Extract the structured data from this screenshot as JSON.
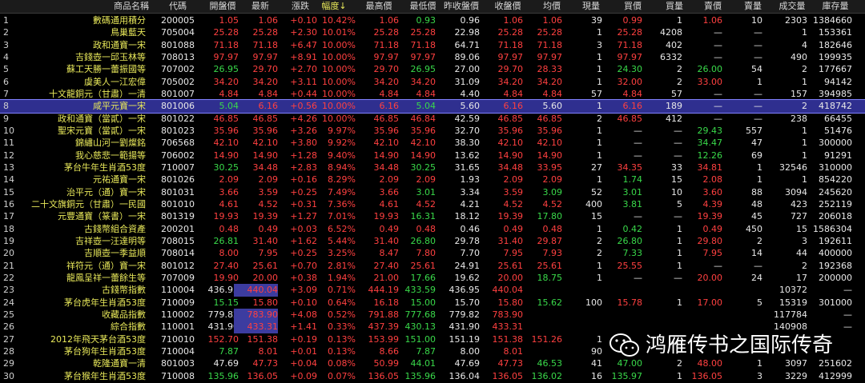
{
  "columns": [
    {
      "key": "name",
      "label": "商品名稱"
    },
    {
      "key": "code",
      "label": "代碼"
    },
    {
      "key": "open",
      "label": "開盤價"
    },
    {
      "key": "last",
      "label": "最新"
    },
    {
      "key": "chg",
      "label": "漲跌"
    },
    {
      "key": "pct",
      "label": "幅度↓"
    },
    {
      "key": "high",
      "label": "最高價"
    },
    {
      "key": "low",
      "label": "最低價"
    },
    {
      "key": "prev",
      "label": "昨收盤價"
    },
    {
      "key": "close",
      "label": "收盤價"
    },
    {
      "key": "avg",
      "label": "均價"
    },
    {
      "key": "vol_now",
      "label": "現量"
    },
    {
      "key": "bid",
      "label": "買價"
    },
    {
      "key": "bid_vol",
      "label": "買量"
    },
    {
      "key": "ask",
      "label": "賣價"
    },
    {
      "key": "ask_vol",
      "label": "賣量"
    },
    {
      "key": "volume",
      "label": "成交量"
    },
    {
      "key": "stock",
      "label": "庫存量"
    }
  ],
  "selected_row": 8,
  "rows": [
    {
      "n": "1",
      "name": "數碼通用積分",
      "code": "200005",
      "open": "1.05",
      "last": "1.06",
      "chg": "+0.10",
      "pct": "10.42%",
      "high": "1.06",
      "low": "0.93",
      "prev": "0.96",
      "close": "1.06",
      "avg": "1.06",
      "vol_now": "39",
      "bid": "0.99",
      "bid_vol": "1",
      "ask": "1.06",
      "ask_vol": "10",
      "volume": "2303",
      "stock": "1384660"
    },
    {
      "n": "2",
      "name": "鳥巢藍天",
      "code": "705004",
      "open": "25.28",
      "last": "25.28",
      "chg": "+2.30",
      "pct": "10.01%",
      "high": "25.28",
      "low": "25.28",
      "prev": "22.98",
      "close": "25.28",
      "avg": "25.28",
      "vol_now": "1",
      "bid": "25.28",
      "bid_vol": "4208",
      "ask": "—",
      "ask_vol": "—",
      "volume": "1",
      "stock": "153361"
    },
    {
      "n": "3",
      "name": "政和通寶一宋",
      "code": "801088",
      "open": "71.18",
      "last": "71.18",
      "chg": "+6.47",
      "pct": "10.00%",
      "high": "71.18",
      "low": "71.18",
      "prev": "64.71",
      "close": "71.18",
      "avg": "71.18",
      "vol_now": "3",
      "bid": "71.18",
      "bid_vol": "402",
      "ask": "—",
      "ask_vol": "—",
      "volume": "4",
      "stock": "182646"
    },
    {
      "n": "4",
      "name": "吉錢壺一邱玉林等",
      "code": "708013",
      "open": "97.97",
      "last": "97.97",
      "chg": "+8.91",
      "pct": "10.00%",
      "high": "97.97",
      "low": "97.97",
      "prev": "89.06",
      "close": "97.97",
      "avg": "97.97",
      "vol_now": "1",
      "bid": "97.97",
      "bid_vol": "6332",
      "ask": "—",
      "ask_vol": "—",
      "volume": "490",
      "stock": "199935"
    },
    {
      "n": "5",
      "name": "蘇工天勝一蕾振國等",
      "code": "707002",
      "open": "26.95",
      "last": "29.70",
      "chg": "+2.70",
      "pct": "10.00%",
      "high": "29.70",
      "low": "26.95",
      "prev": "27.00",
      "close": "29.70",
      "avg": "28.33",
      "vol_now": "1",
      "bid": "24.30",
      "bid_vol": "2",
      "ask": "26.00",
      "ask_vol": "54",
      "volume": "2",
      "stock": "177667"
    },
    {
      "n": "6",
      "name": "虞美人一江宏偉",
      "code": "705002",
      "open": "34.20",
      "last": "34.20",
      "chg": "+3.11",
      "pct": "10.00%",
      "high": "34.20",
      "low": "34.20",
      "prev": "31.09",
      "close": "34.20",
      "avg": "34.20",
      "vol_now": "1",
      "bid": "32.00",
      "bid_vol": "2",
      "ask": "33.00",
      "ask_vol": "1",
      "volume": "1",
      "stock": "94142"
    },
    {
      "n": "7",
      "name": "十文龍銅元（甘肅）一清",
      "code": "801007",
      "open": "4.84",
      "last": "4.84",
      "chg": "+0.44",
      "pct": "10.00%",
      "high": "4.84",
      "low": "4.84",
      "prev": "4.40",
      "close": "4.84",
      "avg": "4.84",
      "vol_now": "57",
      "bid": "4.84",
      "bid_vol": "57",
      "ask": "—",
      "ask_vol": "—",
      "volume": "157",
      "stock": "394985"
    },
    {
      "n": "8",
      "name": "咸平元寶一宋",
      "code": "801006",
      "open": "5.04",
      "last": "6.16",
      "chg": "+0.56",
      "pct": "10.00%",
      "high": "6.16",
      "low": "5.04",
      "prev": "5.60",
      "close": "6.16",
      "avg": "5.60",
      "vol_now": "1",
      "bid": "6.16",
      "bid_vol": "189",
      "ask": "—",
      "ask_vol": "—",
      "volume": "2",
      "stock": "418742"
    },
    {
      "n": "9",
      "name": "政和通寶（當貳）一宋",
      "code": "801022",
      "open": "46.85",
      "last": "46.85",
      "chg": "+4.26",
      "pct": "10.00%",
      "high": "46.85",
      "low": "46.84",
      "prev": "42.59",
      "close": "46.85",
      "avg": "46.85",
      "vol_now": "2",
      "bid": "46.85",
      "bid_vol": "412",
      "ask": "—",
      "ask_vol": "—",
      "volume": "238",
      "stock": "66455"
    },
    {
      "n": "10",
      "name": "聖宋元寶（當貳）一宋",
      "code": "801023",
      "open": "35.96",
      "last": "35.96",
      "chg": "+3.26",
      "pct": "9.97%",
      "high": "35.96",
      "low": "35.96",
      "prev": "32.70",
      "close": "35.96",
      "avg": "35.96",
      "vol_now": "1",
      "bid": "—",
      "bid_vol": "—",
      "ask": "29.43",
      "ask_vol": "557",
      "volume": "1",
      "stock": "51476"
    },
    {
      "n": "11",
      "name": "錦繡山河一劉燦銘",
      "code": "706568",
      "open": "42.10",
      "last": "42.10",
      "chg": "+3.80",
      "pct": "9.92%",
      "high": "42.10",
      "low": "42.10",
      "prev": "38.30",
      "close": "42.10",
      "avg": "42.10",
      "vol_now": "1",
      "bid": "—",
      "bid_vol": "—",
      "ask": "34.47",
      "ask_vol": "47",
      "volume": "1",
      "stock": "300000"
    },
    {
      "n": "12",
      "name": "我心慈悲一範揚等",
      "code": "706002",
      "open": "14.90",
      "last": "14.90",
      "chg": "+1.28",
      "pct": "9.40%",
      "high": "14.90",
      "low": "14.90",
      "prev": "13.62",
      "close": "14.90",
      "avg": "14.90",
      "vol_now": "1",
      "bid": "—",
      "bid_vol": "—",
      "ask": "12.26",
      "ask_vol": "69",
      "volume": "1",
      "stock": "91291"
    },
    {
      "n": "13",
      "name": "茅台牛年生肖酒53度",
      "code": "710007",
      "open": "30.25",
      "last": "34.48",
      "chg": "+2.83",
      "pct": "8.94%",
      "high": "34.48",
      "low": "30.25",
      "prev": "31.65",
      "close": "34.48",
      "avg": "33.95",
      "vol_now": "27",
      "bid": "34.35",
      "bid_vol": "33",
      "ask": "34.81",
      "ask_vol": "1",
      "volume": "32546",
      "stock": "310000"
    },
    {
      "n": "14",
      "name": "元祐通寶一宋",
      "code": "801026",
      "open": "2.09",
      "last": "2.09",
      "chg": "+0.16",
      "pct": "8.29%",
      "high": "2.09",
      "low": "2.09",
      "prev": "1.93",
      "close": "2.09",
      "avg": "2.09",
      "vol_now": "1",
      "bid": "1.74",
      "bid_vol": "15",
      "ask": "2.08",
      "ask_vol": "1",
      "volume": "1",
      "stock": "854220"
    },
    {
      "n": "15",
      "name": "治平元（通）寶一宋",
      "code": "801031",
      "open": "3.66",
      "last": "3.59",
      "chg": "+0.25",
      "pct": "7.49%",
      "high": "3.66",
      "low": "3.01",
      "prev": "3.34",
      "close": "3.59",
      "avg": "3.09",
      "vol_now": "52",
      "bid": "3.01",
      "bid_vol": "10",
      "ask": "3.60",
      "ask_vol": "88",
      "volume": "3094",
      "stock": "245620"
    },
    {
      "n": "16",
      "name": "二十文旗銅元（甘肅）一民國",
      "code": "801010",
      "open": "4.61",
      "last": "4.52",
      "chg": "+0.31",
      "pct": "7.36%",
      "high": "4.61",
      "low": "4.52",
      "prev": "4.21",
      "close": "4.52",
      "avg": "4.52",
      "vol_now": "400",
      "bid": "3.81",
      "bid_vol": "5",
      "ask": "4.39",
      "ask_vol": "48",
      "volume": "423",
      "stock": "252119"
    },
    {
      "n": "17",
      "name": "元豐通寶（篆書）一宋",
      "code": "801319",
      "open": "19.93",
      "last": "19.39",
      "chg": "+1.27",
      "pct": "7.01%",
      "high": "19.93",
      "low": "16.31",
      "prev": "18.12",
      "close": "19.39",
      "avg": "17.80",
      "vol_now": "15",
      "bid": "—",
      "bid_vol": "—",
      "ask": "19.39",
      "ask_vol": "45",
      "volume": "727",
      "stock": "206018"
    },
    {
      "n": "18",
      "name": "古錢幣組合資產",
      "code": "200201",
      "open": "0.48",
      "last": "0.49",
      "chg": "+0.03",
      "pct": "6.52%",
      "high": "0.49",
      "low": "0.48",
      "prev": "0.46",
      "close": "0.49",
      "avg": "0.48",
      "vol_now": "1",
      "bid": "0.42",
      "bid_vol": "1",
      "ask": "0.49",
      "ask_vol": "450",
      "volume": "15",
      "stock": "1586304"
    },
    {
      "n": "19",
      "name": "吉祥壺一汪達明等",
      "code": "708015",
      "open": "26.81",
      "last": "31.40",
      "chg": "+1.62",
      "pct": "5.44%",
      "high": "31.40",
      "low": "26.80",
      "prev": "29.78",
      "close": "31.40",
      "avg": "29.87",
      "vol_now": "2",
      "bid": "26.80",
      "bid_vol": "1",
      "ask": "29.80",
      "ask_vol": "2",
      "volume": "3",
      "stock": "192611"
    },
    {
      "n": "20",
      "name": "吉順壺一季益順",
      "code": "708014",
      "open": "8.00",
      "last": "7.95",
      "chg": "+0.25",
      "pct": "3.25%",
      "high": "8.47",
      "low": "7.80",
      "prev": "7.70",
      "close": "7.95",
      "avg": "7.93",
      "vol_now": "2",
      "bid": "7.33",
      "bid_vol": "1",
      "ask": "7.95",
      "ask_vol": "14",
      "volume": "44",
      "stock": "400000"
    },
    {
      "n": "21",
      "name": "祥符元（通）寶一宋",
      "code": "801012",
      "open": "27.40",
      "last": "25.61",
      "chg": "+0.70",
      "pct": "2.81%",
      "high": "27.40",
      "low": "25.61",
      "prev": "24.91",
      "close": "25.61",
      "avg": "25.61",
      "vol_now": "1",
      "bid": "25.55",
      "bid_vol": "1",
      "ask": "—",
      "ask_vol": "—",
      "volume": "2",
      "stock": "192368"
    },
    {
      "n": "22",
      "name": "龍鳳呈祥一蕾餘生等",
      "code": "707009",
      "open": "19.90",
      "last": "20.00",
      "chg": "+0.38",
      "pct": "1.94%",
      "high": "21.00",
      "low": "17.66",
      "prev": "19.62",
      "close": "20.00",
      "avg": "18.75",
      "vol_now": "1",
      "bid": "—",
      "bid_vol": "—",
      "ask": "20.00",
      "ask_vol": "24",
      "volume": "17",
      "stock": "200000"
    },
    {
      "n": "23",
      "name": "古錢幣指數",
      "code": "110004",
      "open": "436.95",
      "last": "440.04",
      "chg": "+3.09",
      "pct": "0.71%",
      "high": "444.19",
      "low": "433.59",
      "prev": "436.95",
      "close": "440.04",
      "avg": "",
      "vol_now": "",
      "bid": "",
      "bid_vol": "",
      "ask": "",
      "ask_vol": "",
      "volume": "10372",
      "stock": "—"
    },
    {
      "n": "24",
      "name": "茅台虎年生肖酒53度",
      "code": "710009",
      "open": "15.15",
      "last": "15.80",
      "chg": "+0.10",
      "pct": "0.64%",
      "high": "16.18",
      "low": "15.00",
      "prev": "15.70",
      "close": "15.80",
      "avg": "15.62",
      "vol_now": "100",
      "bid": "15.78",
      "bid_vol": "1",
      "ask": "17.00",
      "ask_vol": "5",
      "volume": "15319",
      "stock": "301000"
    },
    {
      "n": "25",
      "name": "收藏品指數",
      "code": "110002",
      "open": "779.82",
      "last": "783.90",
      "chg": "+4.08",
      "pct": "0.52%",
      "high": "791.88",
      "low": "777.68",
      "prev": "779.82",
      "close": "783.90",
      "avg": "",
      "vol_now": "",
      "bid": "",
      "bid_vol": "",
      "ask": "",
      "ask_vol": "",
      "volume": "117784",
      "stock": "—"
    },
    {
      "n": "26",
      "name": "綜合指數",
      "code": "110001",
      "open": "431.90",
      "last": "433.31",
      "chg": "+1.41",
      "pct": "0.33%",
      "high": "437.39",
      "low": "430.13",
      "prev": "431.90",
      "close": "433.31",
      "avg": "",
      "vol_now": "",
      "bid": "",
      "bid_vol": "",
      "ask": "",
      "ask_vol": "",
      "volume": "140908",
      "stock": "—"
    },
    {
      "n": "27",
      "name": "2012年飛天茅台酒53度",
      "code": "710010",
      "open": "152.70",
      "last": "151.38",
      "chg": "+0.19",
      "pct": "0.13%",
      "high": "153.99",
      "low": "151.00",
      "prev": "151.19",
      "close": "151.38",
      "avg": "151.26",
      "vol_now": "1",
      "bid": "",
      "bid_vol": "",
      "ask": "",
      "ask_vol": "",
      "volume": "",
      "stock": ""
    },
    {
      "n": "28",
      "name": "茅台狗年生肖酒53度",
      "code": "710004",
      "open": "7.87",
      "last": "8.01",
      "chg": "+0.01",
      "pct": "0.13%",
      "high": "8.66",
      "low": "7.87",
      "prev": "8.00",
      "close": "8.01",
      "avg": "",
      "vol_now": "90",
      "bid": "",
      "bid_vol": "",
      "ask": "",
      "ask_vol": "",
      "volume": "",
      "stock": ""
    },
    {
      "n": "29",
      "name": "乾隆通寶一清",
      "code": "801003",
      "open": "47.69",
      "last": "47.73",
      "chg": "+0.04",
      "pct": "0.08%",
      "high": "50.99",
      "low": "44.01",
      "prev": "47.69",
      "close": "47.73",
      "avg": "46.53",
      "vol_now": "41",
      "bid": "47.00",
      "bid_vol": "2",
      "ask": "48.00",
      "ask_vol": "1",
      "volume": "3097",
      "stock": "251602"
    },
    {
      "n": "30",
      "name": "茅台猴年生肖酒53度",
      "code": "710008",
      "open": "135.96",
      "last": "136.05",
      "chg": "+0.09",
      "pct": "0.07%",
      "high": "136.05",
      "low": "135.96",
      "prev": "136.04",
      "close": "136.05",
      "avg": "136.02",
      "vol_now": "16",
      "bid": "135.97",
      "bid_vol": "1",
      "ask": "136.05",
      "ask_vol": "3",
      "volume": "3229",
      "stock": "412999"
    }
  ],
  "watermark": {
    "text": "鸿雁传书之国际传奇",
    "icon": "wechat-icon"
  },
  "colors": {
    "up": "#ff4040",
    "down": "#39d94a",
    "name": "#e8e85a",
    "flat": "#e8e8e8",
    "selected_bg": "#2f2f8f",
    "background": "#000000"
  }
}
